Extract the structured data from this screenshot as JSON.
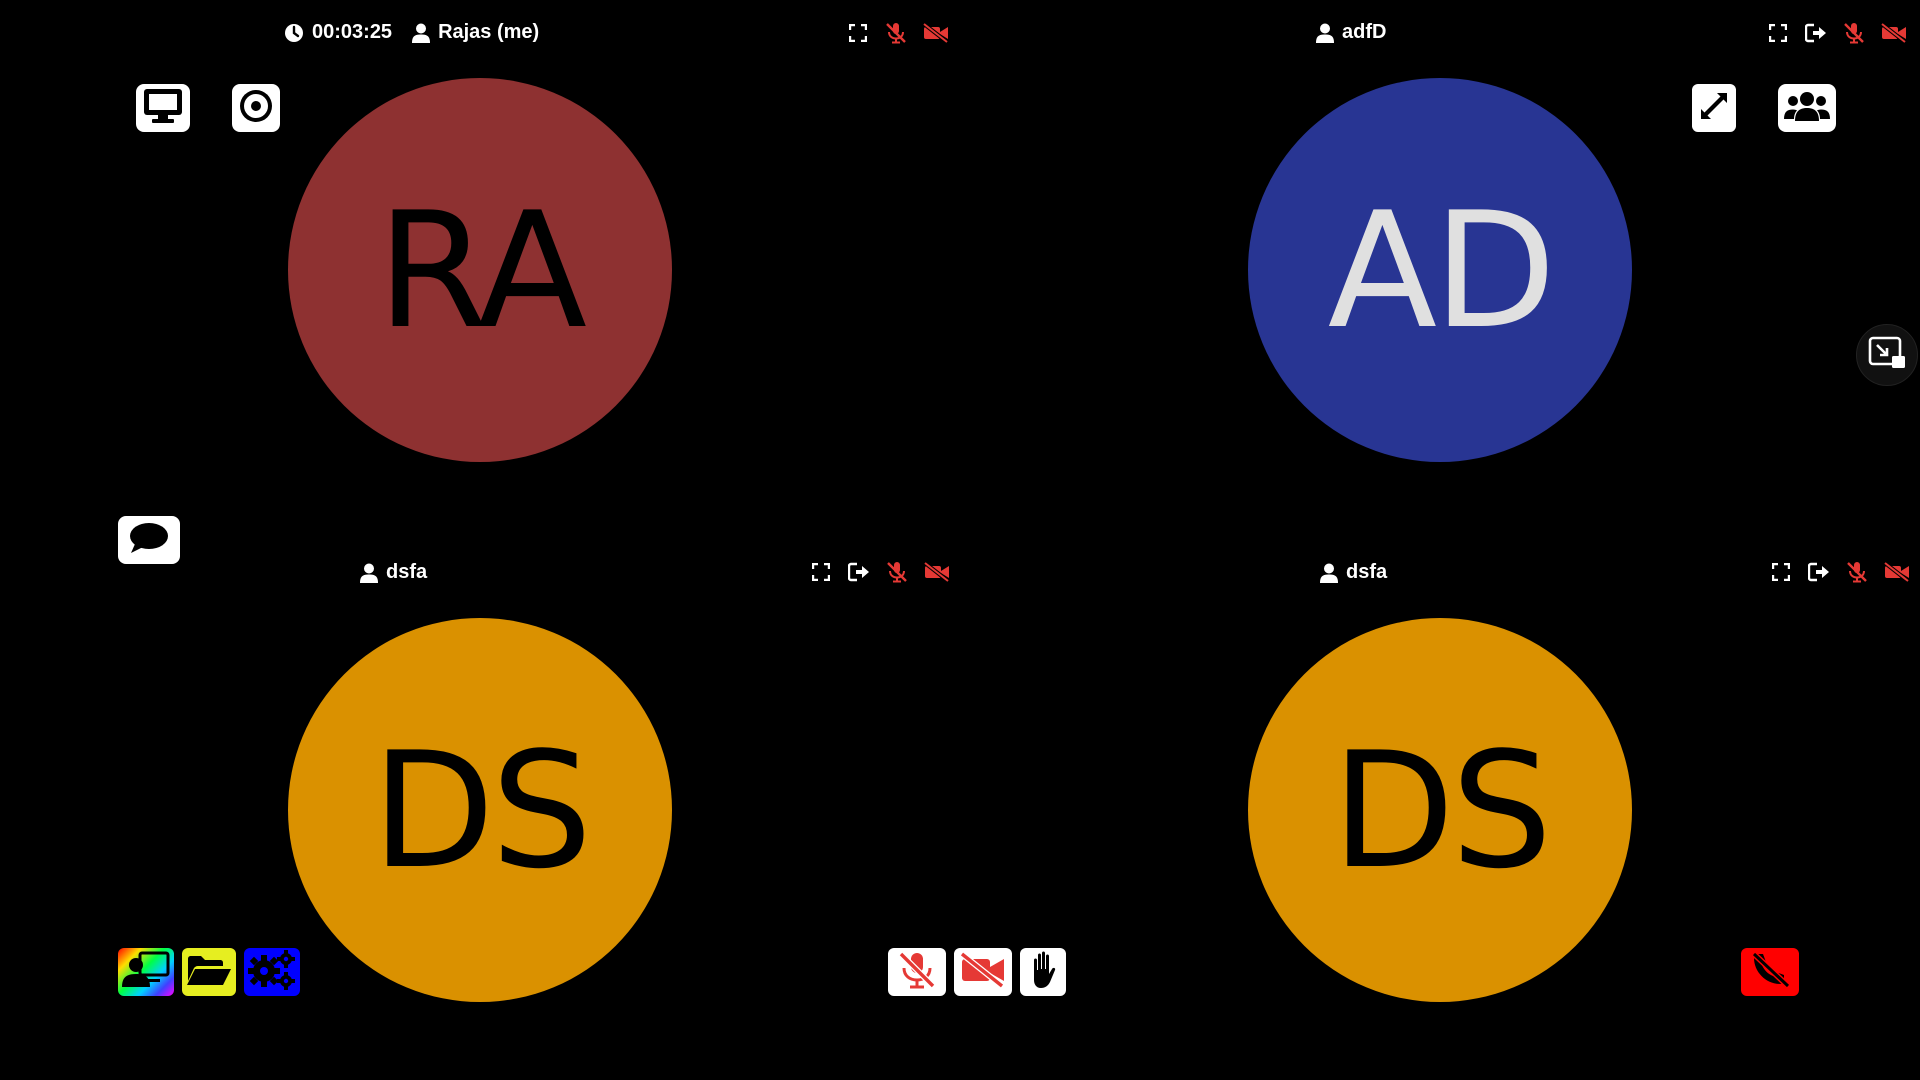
{
  "colors": {
    "background": "#000000",
    "muted_red": "#e53935",
    "hangup_red": "#ff0000",
    "avatar_ra": "#8e3131",
    "avatar_ad": "#283593",
    "avatar_ds": "#da9100",
    "folder_yellow": "#e6ee20",
    "settings_blue": "#0000ff"
  },
  "session": {
    "timer": "00:03:25"
  },
  "tiles": [
    {
      "name": "Rajas (me)",
      "initials": "RA",
      "avatar_color": "#8e3131",
      "text_color": "#000000"
    },
    {
      "name": "adfD",
      "initials": "AD",
      "avatar_color": "#283593",
      "text_color": "#e0e0e0"
    },
    {
      "name": "dsfa",
      "initials": "DS",
      "avatar_color": "#da9100",
      "text_color": "#000000"
    },
    {
      "name": "dsfa",
      "initials": "DS",
      "avatar_color": "#da9100",
      "text_color": "#000000"
    }
  ],
  "icons": {
    "clock": "clock-icon",
    "user": "user-icon",
    "fullscreen": "fullscreen-icon",
    "kick": "sign-out-icon",
    "mic_off": "microphone-slash-icon",
    "video_off": "video-slash-icon",
    "screen_share": "desktop-icon",
    "record": "record-icon",
    "expand": "expand-icon",
    "participants": "users-icon",
    "pip": "picture-in-picture-icon",
    "chat": "chat-icon",
    "hand": "raise-hand-icon",
    "hangup": "phone-hangup-icon",
    "files": "folder-open-icon",
    "settings": "cogs-icon",
    "swap": "user-swap-icon"
  }
}
